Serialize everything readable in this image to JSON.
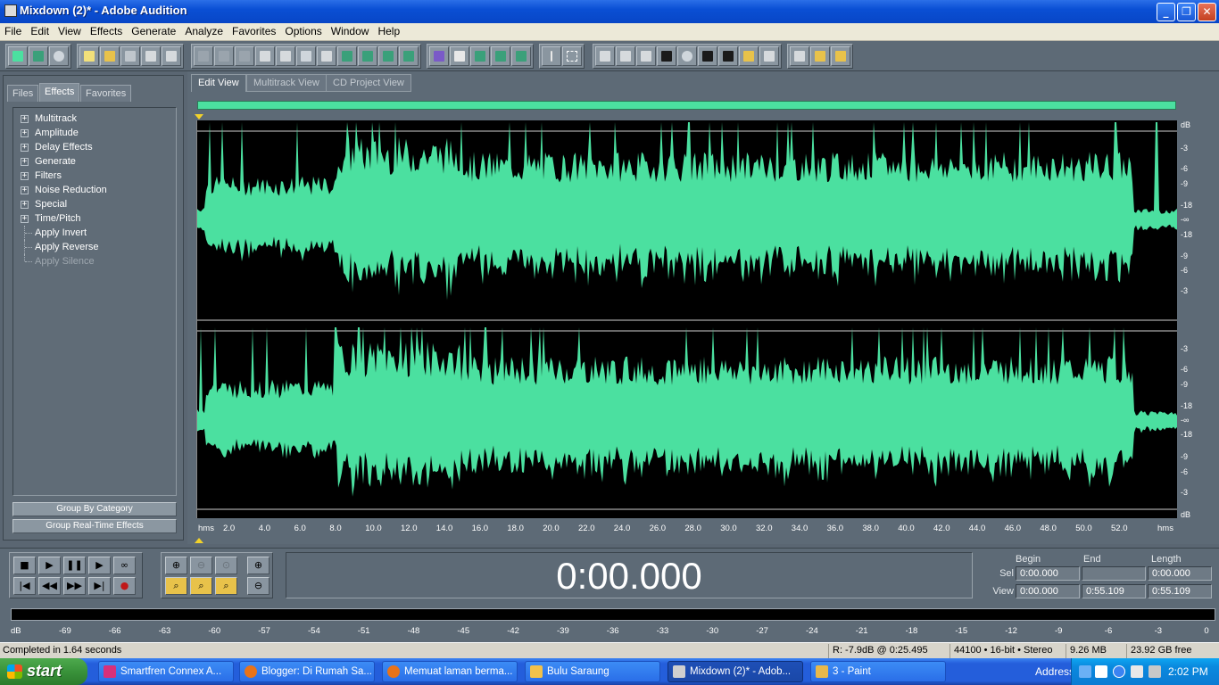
{
  "window": {
    "title": "Mixdown (2)* - Adobe Audition",
    "min": "_",
    "max": "❐",
    "close": "✕"
  },
  "menu": [
    "File",
    "Edit",
    "View",
    "Effects",
    "Generate",
    "Analyze",
    "Favorites",
    "Options",
    "Window",
    "Help"
  ],
  "left_panel": {
    "tabs": [
      "Files",
      "Effects",
      "Favorites"
    ],
    "active_tab": "Effects",
    "tree": [
      {
        "label": "Multitrack",
        "expandable": true
      },
      {
        "label": "Amplitude",
        "expandable": true
      },
      {
        "label": "Delay Effects",
        "expandable": true
      },
      {
        "label": "Generate",
        "expandable": true
      },
      {
        "label": "Filters",
        "expandable": true
      },
      {
        "label": "Noise Reduction",
        "expandable": true
      },
      {
        "label": "Special",
        "expandable": true
      },
      {
        "label": "Time/Pitch",
        "expandable": true
      },
      {
        "label": "Apply Invert",
        "expandable": false
      },
      {
        "label": "Apply Reverse",
        "expandable": false
      },
      {
        "label": "Apply Silence",
        "expandable": false,
        "disabled": true
      }
    ],
    "btn_group_category": "Group By Category",
    "btn_group_realtime": "Group Real-Time Effects"
  },
  "view_tabs": [
    "Edit View",
    "Multitrack View",
    "CD Project View"
  ],
  "db_ruler_top": [
    "dB",
    "-3",
    "-6",
    "-9",
    "-18",
    "-∞",
    "-18",
    "-9",
    "-6",
    "-3"
  ],
  "db_ruler_bottom": [
    "-3",
    "-6",
    "-9",
    "-18",
    "-∞",
    "-18",
    "-9",
    "-6",
    "-3",
    "dB"
  ],
  "time_ruler": [
    "hms",
    "2.0",
    "4.0",
    "6.0",
    "8.0",
    "10.0",
    "12.0",
    "14.0",
    "16.0",
    "18.0",
    "20.0",
    "22.0",
    "24.0",
    "26.0",
    "28.0",
    "30.0",
    "32.0",
    "34.0",
    "36.0",
    "38.0",
    "40.0",
    "42.0",
    "44.0",
    "46.0",
    "48.0",
    "50.0",
    "52.0",
    "hms"
  ],
  "clock": "0:00.000",
  "selection": {
    "headers": [
      "Begin",
      "End",
      "Length"
    ],
    "sel_label": "Sel",
    "view_label": "View",
    "sel": {
      "begin": "0:00.000",
      "end": "",
      "length": "0:00.000"
    },
    "view": {
      "begin": "0:00.000",
      "end": "0:55.109",
      "length": "0:55.109"
    }
  },
  "level_ticks": [
    "dB",
    "-69",
    "-66",
    "-63",
    "-60",
    "-57",
    "-54",
    "-51",
    "-48",
    "-45",
    "-42",
    "-39",
    "-36",
    "-33",
    "-30",
    "-27",
    "-24",
    "-21",
    "-18",
    "-15",
    "-12",
    "-9",
    "-6",
    "-3",
    "0"
  ],
  "status": {
    "message": "Completed in 1.64 seconds",
    "cursor": "R: -7.9dB @   0:25.495",
    "format": "44100 • 16-bit • Stereo",
    "size": "9.26 MB",
    "free": "23.92 GB free"
  },
  "taskbar": {
    "start": "start",
    "tasks": [
      {
        "label": "Smartfren Connex A...",
        "color": "#d8307a"
      },
      {
        "label": "Blogger: Di Rumah Sa...",
        "color": "#e8731a"
      },
      {
        "label": "Memuat laman berma...",
        "color": "#e8731a"
      },
      {
        "label": "Bulu Saraung",
        "color": "#f2c14a"
      },
      {
        "label": "Mixdown (2)* - Adob...",
        "color": "#cfcfcf",
        "active": true
      },
      {
        "label": "3 - Paint",
        "color": "#e8b84a"
      }
    ],
    "address": "Address",
    "time": "2:02 PM"
  },
  "colors": {
    "waveform": "#4be0a0",
    "wave_bg": "#000000",
    "panel": "#5d6a76"
  }
}
